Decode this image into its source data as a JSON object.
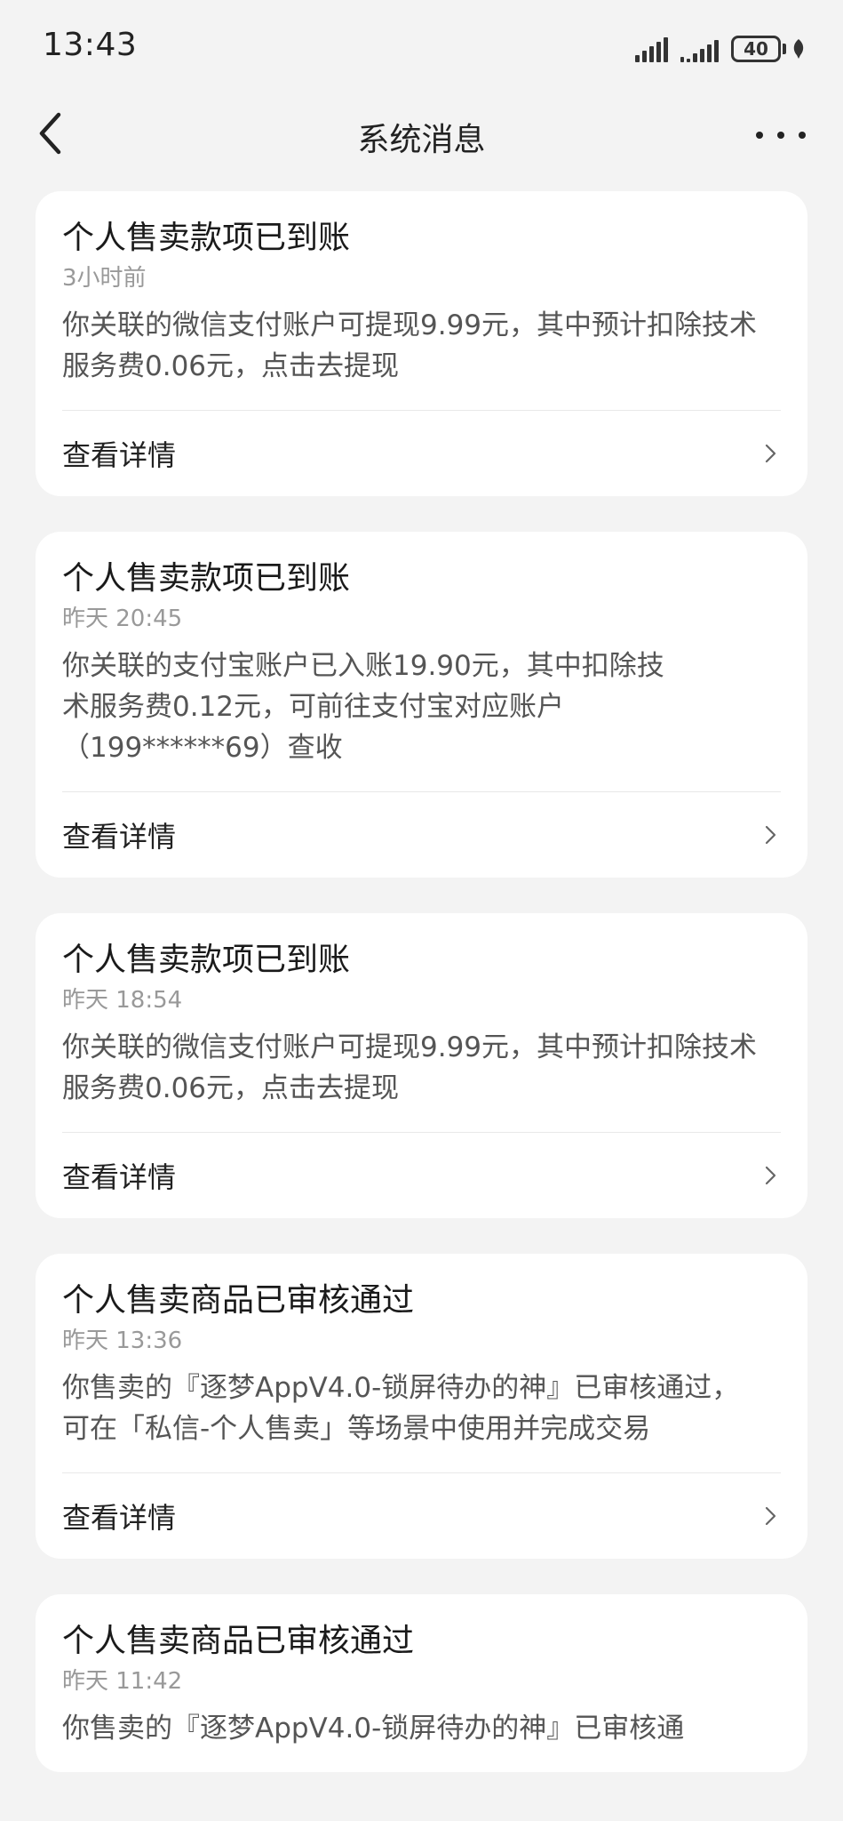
{
  "status_bar": {
    "time": "13:43",
    "battery": "40"
  },
  "nav": {
    "title": "系统消息"
  },
  "messages": [
    {
      "title": "个人售卖款项已到账",
      "time": "3小时前",
      "body": "你关联的微信支付账户可提现9.99元，其中预计扣除技术服务费0.06元，点击去提现",
      "action": "查看详情"
    },
    {
      "title": "个人售卖款项已到账",
      "time": "昨天 20:45",
      "body": "你关联的支付宝账户已入账19.90元，其中扣除技术服务费0.12元，可前往支付宝对应账户（199******69）查收",
      "action": "查看详情"
    },
    {
      "title": "个人售卖款项已到账",
      "time": "昨天 18:54",
      "body": "你关联的微信支付账户可提现9.99元，其中预计扣除技术服务费0.06元，点击去提现",
      "action": "查看详情"
    },
    {
      "title": "个人售卖商品已审核通过",
      "time": "昨天 13:36",
      "body": "你售卖的『逐梦AppV4.0-锁屏待办的神』已审核通过，可在「私信-个人售卖」等场景中使用并完成交易",
      "action": "查看详情"
    },
    {
      "title": "个人售卖商品已审核通过",
      "time": "昨天 11:42",
      "body": "你售卖的『逐梦AppV4.0-锁屏待办的神』已审核通",
      "action": ""
    }
  ],
  "icons": {
    "back": "back-arrow-icon",
    "more": "more-icon",
    "chevron": "chevron-right-icon"
  }
}
